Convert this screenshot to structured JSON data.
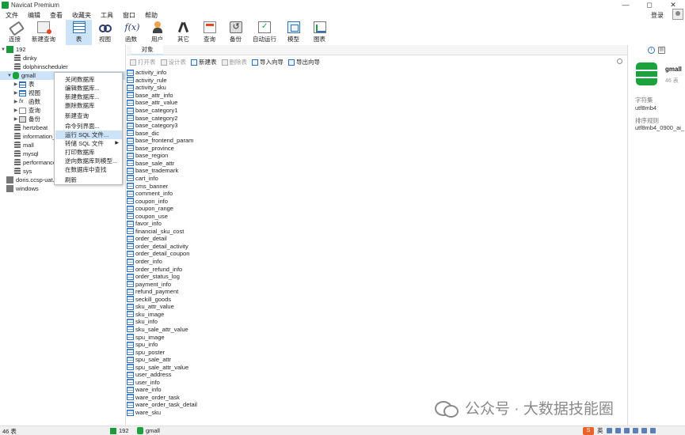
{
  "window": {
    "title": "Navicat Premium",
    "controls": [
      "—",
      "◻",
      "✕"
    ]
  },
  "menubar": {
    "items": [
      "文件",
      "编辑",
      "查看",
      "收藏夹",
      "工具",
      "窗口",
      "帮助"
    ],
    "login": "登录"
  },
  "toolbar": {
    "buttons": [
      {
        "label": "连接",
        "icon": "connection-icon"
      },
      {
        "label": "新建查询",
        "icon": "new-query-icon"
      },
      {
        "label": "表",
        "icon": "table-icon",
        "active": true
      },
      {
        "label": "视图",
        "icon": "view-icon"
      },
      {
        "label": "函数",
        "icon": "function-icon"
      },
      {
        "label": "用户",
        "icon": "user-icon"
      },
      {
        "label": "其它",
        "icon": "tools-icon"
      },
      {
        "label": "查询",
        "icon": "query-icon"
      },
      {
        "label": "备份",
        "icon": "backup-icon"
      },
      {
        "label": "自动运行",
        "icon": "automation-icon"
      },
      {
        "label": "模型",
        "icon": "model-icon"
      },
      {
        "label": "图表",
        "icon": "chart-icon"
      }
    ]
  },
  "tree": {
    "connection": "192",
    "databases_top": [
      "dinky",
      "dolphinscheduler",
      "gmall"
    ],
    "gmall_children": [
      "表",
      "视图",
      "函数",
      "查询",
      "备份"
    ],
    "databases_rest": [
      "hertzbeat",
      "information_",
      "mall",
      "mysql",
      "performance",
      "sys"
    ],
    "other_connections": [
      "doris.ccsp-uat.l",
      "windows"
    ]
  },
  "context_menu": {
    "items": [
      {
        "label": "关闭数据库"
      },
      {
        "label": "编辑数据库..."
      },
      {
        "label": "新建数据库..."
      },
      {
        "label": "删除数据库"
      },
      {
        "label": "新建查询"
      },
      {
        "label": "命令列界面..."
      },
      {
        "label": "运行 SQL 文件...",
        "highlighted": true
      },
      {
        "label": "转储 SQL 文件",
        "submenu": true
      },
      {
        "label": "打印数据库"
      },
      {
        "label": "逆向数据库到模型..."
      },
      {
        "label": "在数据库中查找"
      },
      {
        "label": "刷新"
      }
    ],
    "submenu_arrow": "▶"
  },
  "tabs": {
    "objects": "对象"
  },
  "object_toolbar": {
    "open": "打开表",
    "design": "设计表",
    "new": "新建表",
    "delete": "删除表",
    "import": "导入向导",
    "export": "导出向导"
  },
  "tables": [
    "activity_info",
    "activity_rule",
    "activity_sku",
    "base_attr_info",
    "base_attr_value",
    "base_category1",
    "base_category2",
    "base_category3",
    "base_dic",
    "base_frontend_param",
    "base_province",
    "base_region",
    "base_sale_attr",
    "base_trademark",
    "cart_info",
    "cms_banner",
    "comment_info",
    "coupon_info",
    "coupon_range",
    "coupon_use",
    "favor_info",
    "financial_sku_cost",
    "order_detail",
    "order_detail_activity",
    "order_detail_coupon",
    "order_info",
    "order_refund_info",
    "order_status_log",
    "payment_info",
    "refund_payment",
    "seckill_goods",
    "sku_attr_value",
    "sku_image",
    "sku_info",
    "sku_sale_attr_value",
    "spu_image",
    "spu_info",
    "spu_poster",
    "spu_sale_attr",
    "spu_sale_attr_value",
    "user_address",
    "user_info",
    "ware_info",
    "ware_order_task",
    "ware_order_task_detail",
    "ware_sku"
  ],
  "info_panel": {
    "name": "gmall",
    "count": "46 表",
    "charset_label": "字符集",
    "charset_value": "utf8mb4",
    "collation_label": "排序规则",
    "collation_value": "utf8mb4_0900_ai_",
    "tab_info": "i",
    "tab_ddl": "▤"
  },
  "statusbar": {
    "count": "46 表",
    "connection": "192",
    "database": "gmall",
    "ime_logo": "S",
    "ime_lang": "英"
  },
  "watermark": {
    "text": "公众号 · 大数据技能圈"
  },
  "colors": {
    "selection": "#cde3f7",
    "accent_green": "#1aa33c",
    "accent_blue": "#2a6fc6"
  }
}
